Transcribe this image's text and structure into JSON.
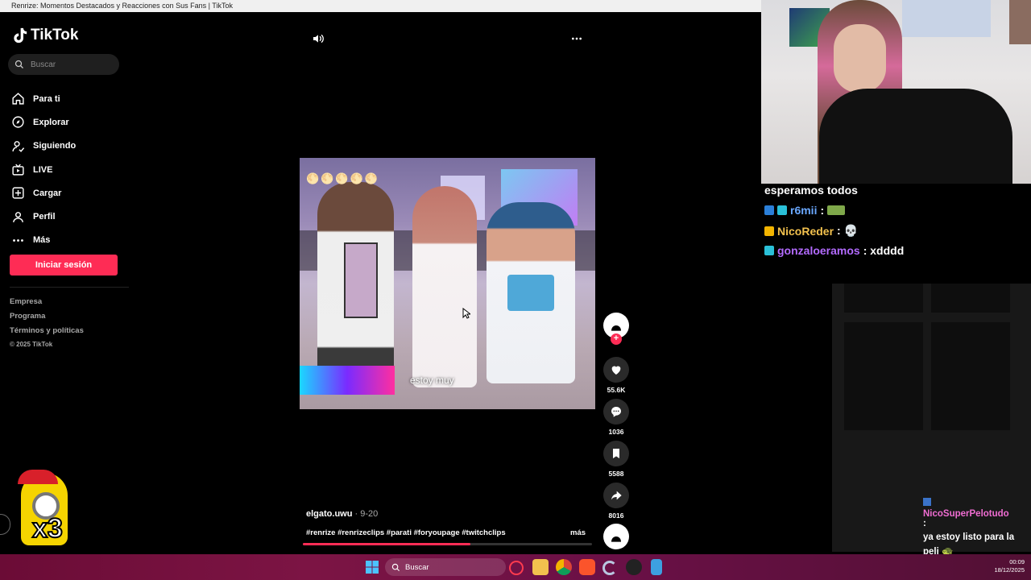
{
  "window": {
    "title": "Renrize: Momentos Destacados y Reacciones con Sus Fans | TikTok"
  },
  "sidebar": {
    "logo": "TikTok",
    "search_placeholder": "Buscar",
    "nav": [
      {
        "label": "Para ti",
        "icon": "home-icon"
      },
      {
        "label": "Explorar",
        "icon": "compass-icon"
      },
      {
        "label": "Siguiendo",
        "icon": "following-icon"
      },
      {
        "label": "LIVE",
        "icon": "live-icon"
      },
      {
        "label": "Cargar",
        "icon": "upload-icon"
      },
      {
        "label": "Perfil",
        "icon": "profile-icon"
      },
      {
        "label": "Más",
        "icon": "more-dots-icon"
      }
    ],
    "login_label": "Iniciar sesión",
    "footer": [
      "Empresa",
      "Programa",
      "Términos y políticas"
    ],
    "copyright": "© 2025 TikTok"
  },
  "video": {
    "caption_overlay": "estoy muy",
    "author": "elgato.uwu",
    "date": " · 9-20",
    "hashtags": "#renrize #renrizeclips #parati #foryoupage #twitchclips",
    "more_label": "más",
    "progress": 0.58
  },
  "actions": {
    "likes": "55.6K",
    "comments": "1036",
    "saves": "5588",
    "shares": "8016"
  },
  "chat": [
    {
      "user": "",
      "text": "esperamos todos",
      "color": "#ffffff"
    },
    {
      "user": "r6mii",
      "text": " :",
      "color": "#6aa8ff"
    },
    {
      "user": "NicoReder",
      "text": " : 💀",
      "color": "#f2c14e"
    },
    {
      "user": "gonzaloeramos",
      "text": " : xdddd",
      "color": "#b36bff"
    }
  ],
  "bottom_chat": {
    "user": "NicoSuperPelotudo",
    "separator": ":",
    "text": "ya estoy listo para la peli 🐢"
  },
  "overlay_counter": "x3",
  "taskbar": {
    "search_label": "Buscar",
    "time": "00:09",
    "date": "18/12/2025"
  },
  "colors": {
    "accent": "#fe2c55",
    "background": "#000000"
  }
}
